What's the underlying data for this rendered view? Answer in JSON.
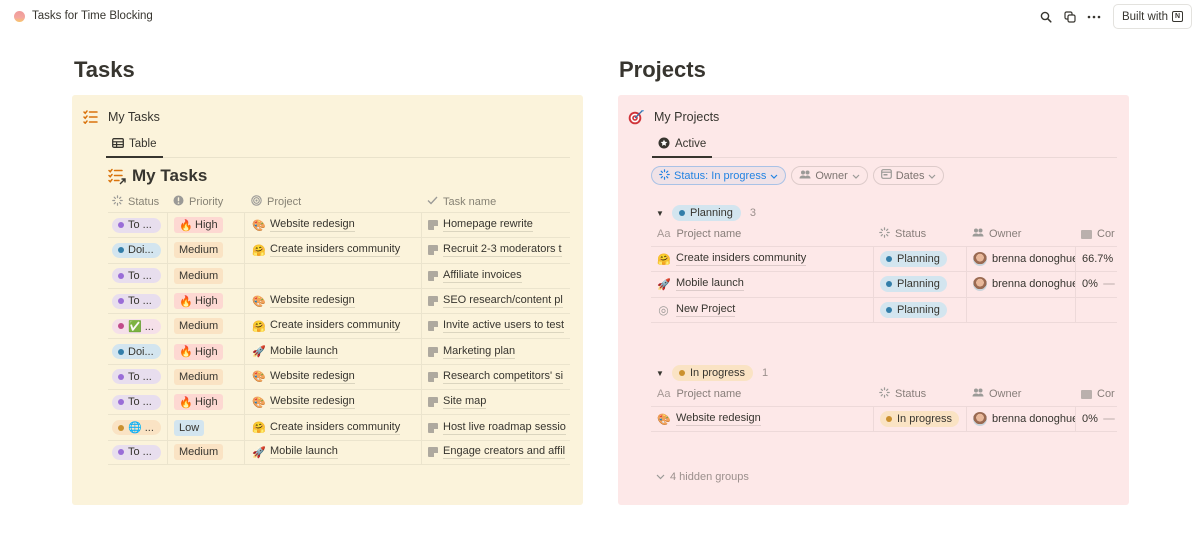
{
  "topbar": {
    "title": "Tasks for Time Blocking",
    "built_with_label": "Built with",
    "icons": [
      "search-icon",
      "duplicate-icon",
      "more-icon",
      "notion-logo-icon"
    ]
  },
  "tasks_section": {
    "heading": "Tasks",
    "database_title": "My Tasks",
    "view_tab": "Table",
    "view_title": "My Tasks",
    "columns": [
      "Status",
      "Priority",
      "Project",
      "Task name"
    ],
    "rows": [
      {
        "status": "To ...",
        "status_color": "#9a6dd7",
        "status_bg": "#e8deee",
        "priority": "High",
        "priority_emoji": "🔥",
        "priority_bg": "#fdd8d2",
        "project": "Website redesign",
        "project_emoji": "🎨",
        "task": "Homepage rewrite"
      },
      {
        "status": "Doi...",
        "status_color": "#337ea9",
        "status_bg": "#d3e5ef",
        "priority": "Medium",
        "priority_emoji": "",
        "priority_bg": "#fae3c4",
        "project": "Create insiders community",
        "project_emoji": "🤗",
        "task": "Recruit 2-3 moderators t"
      },
      {
        "status": "To ...",
        "status_color": "#9a6dd7",
        "status_bg": "#e8deee",
        "priority": "Medium",
        "priority_emoji": "",
        "priority_bg": "#fae3c4",
        "project": "",
        "project_emoji": "",
        "task": "Affiliate invoices"
      },
      {
        "status": "To ...",
        "status_color": "#9a6dd7",
        "status_bg": "#e8deee",
        "priority": "High",
        "priority_emoji": "🔥",
        "priority_bg": "#fdd8d2",
        "project": "Website redesign",
        "project_emoji": "🎨",
        "task": "SEO research/content pl"
      },
      {
        "status": "✅ ...",
        "status_color": "#c14c8a",
        "status_bg": "#f5e0e9",
        "priority": "Medium",
        "priority_emoji": "",
        "priority_bg": "#fae3c4",
        "project": "Create insiders community",
        "project_emoji": "🤗",
        "task": "Invite active users to test"
      },
      {
        "status": "Doi...",
        "status_color": "#337ea9",
        "status_bg": "#d3e5ef",
        "priority": "High",
        "priority_emoji": "🔥",
        "priority_bg": "#fdd8d2",
        "project": "Mobile launch",
        "project_emoji": "🚀",
        "task": "Marketing plan"
      },
      {
        "status": "To ...",
        "status_color": "#9a6dd7",
        "status_bg": "#e8deee",
        "priority": "Medium",
        "priority_emoji": "",
        "priority_bg": "#fae3c4",
        "project": "Website redesign",
        "project_emoji": "🎨",
        "task": "Research competitors' si"
      },
      {
        "status": "To ...",
        "status_color": "#9a6dd7",
        "status_bg": "#e8deee",
        "priority": "High",
        "priority_emoji": "🔥",
        "priority_bg": "#fdd8d2",
        "project": "Website redesign",
        "project_emoji": "🎨",
        "task": "Site map"
      },
      {
        "status": "🌐 ...",
        "status_color": "#cb912f",
        "status_bg": "#fae3c4",
        "priority": "Low",
        "priority_emoji": "",
        "priority_bg": "#d3e5ef",
        "project": "Create insiders community",
        "project_emoji": "🤗",
        "task": "Host live roadmap sessio"
      },
      {
        "status": "To ...",
        "status_color": "#9a6dd7",
        "status_bg": "#e8deee",
        "priority": "Medium",
        "priority_emoji": "",
        "priority_bg": "#fae3c4",
        "project": "Mobile launch",
        "project_emoji": "🚀",
        "task": "Engage creators and affil"
      }
    ]
  },
  "projects_section": {
    "heading": "Projects",
    "database_title": "My Projects",
    "view_tab": "Active",
    "filters": [
      {
        "label": "Status: In progress",
        "active": true
      },
      {
        "label": "Owner",
        "active": false
      },
      {
        "label": "Dates",
        "active": false
      }
    ],
    "columns": [
      "Project name",
      "Status",
      "Owner",
      "Cor"
    ],
    "groups": [
      {
        "label": "Planning",
        "count": "3",
        "color": "#337ea9",
        "bg": "#d3e5ef",
        "rows": [
          {
            "emoji": "🤗",
            "name": "Create insiders community",
            "status": "Planning",
            "owner": "brenna donoghue",
            "completion": "66.7%",
            "show_bar": false
          },
          {
            "emoji": "🚀",
            "name": "Mobile launch",
            "status": "Planning",
            "owner": "brenna donoghue",
            "completion": "0%",
            "show_bar": true
          },
          {
            "emoji": "◎",
            "name": "New Project",
            "status": "Planning",
            "owner": "",
            "completion": "",
            "show_bar": false
          }
        ]
      },
      {
        "label": "In progress",
        "count": "1",
        "color": "#cb912f",
        "bg": "#fae3c4",
        "rows": [
          {
            "emoji": "🎨",
            "name": "Website redesign",
            "status": "In progress",
            "owner": "brenna donoghue",
            "completion": "0%",
            "show_bar": true
          }
        ]
      }
    ],
    "hidden_groups_label": "4 hidden groups"
  }
}
